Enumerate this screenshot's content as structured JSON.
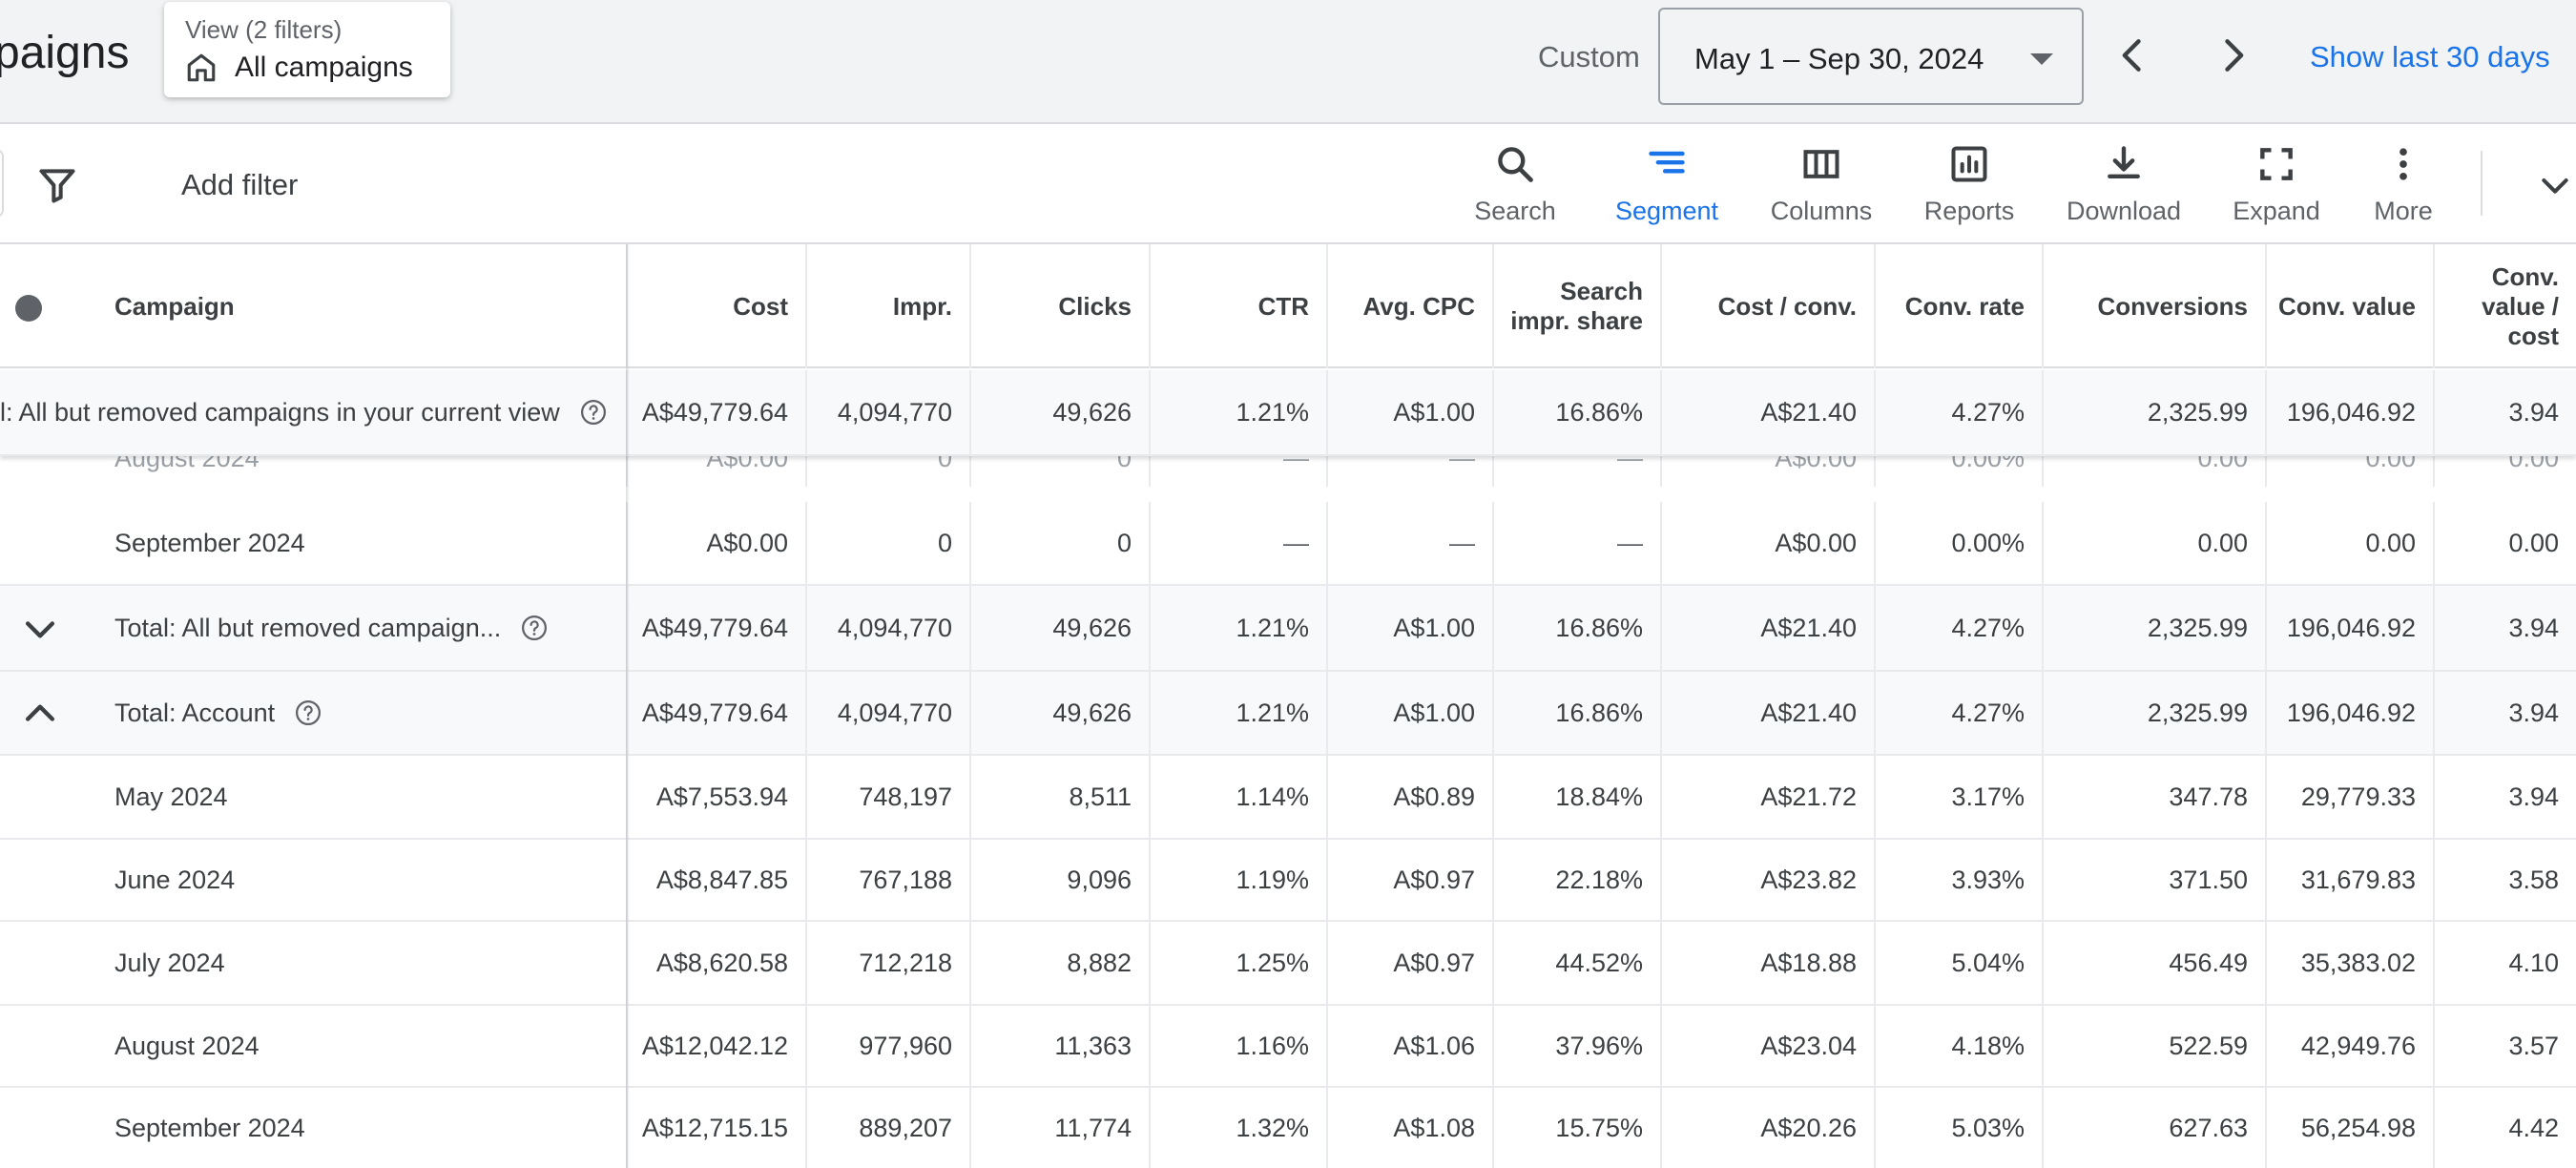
{
  "header": {
    "page_title": "paigns",
    "view_chip": {
      "sub": "View (2 filters)",
      "main": "All campaigns",
      "icon": "home-icon"
    },
    "date_range_label": "Custom",
    "date_range_value": "May 1 – Sep 30, 2024",
    "show_last": "Show last 30 days"
  },
  "toolbar": {
    "add_filter": "Add filter",
    "tools": [
      {
        "label": "Search",
        "icon": "search-icon",
        "active": false
      },
      {
        "label": "Segment",
        "icon": "segment-icon",
        "active": true
      },
      {
        "label": "Columns",
        "icon": "columns-icon",
        "active": false
      },
      {
        "label": "Reports",
        "icon": "reports-icon",
        "active": false
      },
      {
        "label": "Download",
        "icon": "download-icon",
        "active": false
      },
      {
        "label": "Expand",
        "icon": "expand-icon",
        "active": false
      },
      {
        "label": "More",
        "icon": "more-vert-icon",
        "active": false
      }
    ]
  },
  "table": {
    "columns": [
      "Campaign",
      "Cost",
      "Impr.",
      "Clicks",
      "CTR",
      "Avg. CPC",
      "Search impr. share",
      "Cost / conv.",
      "Conv. rate",
      "Conversions",
      "Conv. value",
      "Conv. value / cost"
    ],
    "sticky_total": {
      "label": "l: All but removed campaigns in your current view",
      "values": [
        "A$49,779.64",
        "4,094,770",
        "49,626",
        "1.21%",
        "A$1.00",
        "16.86%",
        "A$21.40",
        "4.27%",
        "2,325.99",
        "196,046.92",
        "3.94"
      ]
    },
    "partial_row": {
      "label": "August 2024",
      "values": [
        "A$0.00",
        "0",
        "0",
        "—",
        "—",
        "—",
        "A$0.00",
        "0.00%",
        "0.00",
        "0.00",
        "0.00"
      ]
    },
    "rows": [
      {
        "label": "September 2024",
        "values": [
          "A$0.00",
          "0",
          "0",
          "—",
          "—",
          "—",
          "A$0.00",
          "0.00%",
          "0.00",
          "0.00",
          "0.00"
        ]
      },
      {
        "label": "Total: All but removed campaign...",
        "chevron": "chevron-down-icon",
        "values": [
          "A$49,779.64",
          "4,094,770",
          "49,626",
          "1.21%",
          "A$1.00",
          "16.86%",
          "A$21.40",
          "4.27%",
          "2,325.99",
          "196,046.92",
          "3.94"
        ]
      },
      {
        "label": "Total: Account",
        "chevron": "chevron-up-icon",
        "values": [
          "A$49,779.64",
          "4,094,770",
          "49,626",
          "1.21%",
          "A$1.00",
          "16.86%",
          "A$21.40",
          "4.27%",
          "2,325.99",
          "196,046.92",
          "3.94"
        ]
      },
      {
        "label": "May 2024",
        "values": [
          "A$7,553.94",
          "748,197",
          "8,511",
          "1.14%",
          "A$0.89",
          "18.84%",
          "A$21.72",
          "3.17%",
          "347.78",
          "29,779.33",
          "3.94"
        ]
      },
      {
        "label": "June 2024",
        "values": [
          "A$8,847.85",
          "767,188",
          "9,096",
          "1.19%",
          "A$0.97",
          "22.18%",
          "A$23.82",
          "3.93%",
          "371.50",
          "31,679.83",
          "3.58"
        ]
      },
      {
        "label": "July 2024",
        "values": [
          "A$8,620.58",
          "712,218",
          "8,882",
          "1.25%",
          "A$0.97",
          "44.52%",
          "A$18.88",
          "5.04%",
          "456.49",
          "35,383.02",
          "4.10"
        ]
      },
      {
        "label": "August 2024",
        "values": [
          "A$12,042.12",
          "977,960",
          "11,363",
          "1.16%",
          "A$1.06",
          "37.96%",
          "A$23.04",
          "4.18%",
          "522.59",
          "42,949.76",
          "3.57"
        ]
      },
      {
        "label": "September 2024",
        "values": [
          "A$12,715.15",
          "889,207",
          "11,774",
          "1.32%",
          "A$1.08",
          "15.75%",
          "A$20.26",
          "5.03%",
          "627.63",
          "56,254.98",
          "4.42"
        ]
      }
    ]
  },
  "colors": {
    "accent": "#1a73e8",
    "header_bg": "#f1f3f4",
    "total_row_bg": "#f8f9fa"
  }
}
